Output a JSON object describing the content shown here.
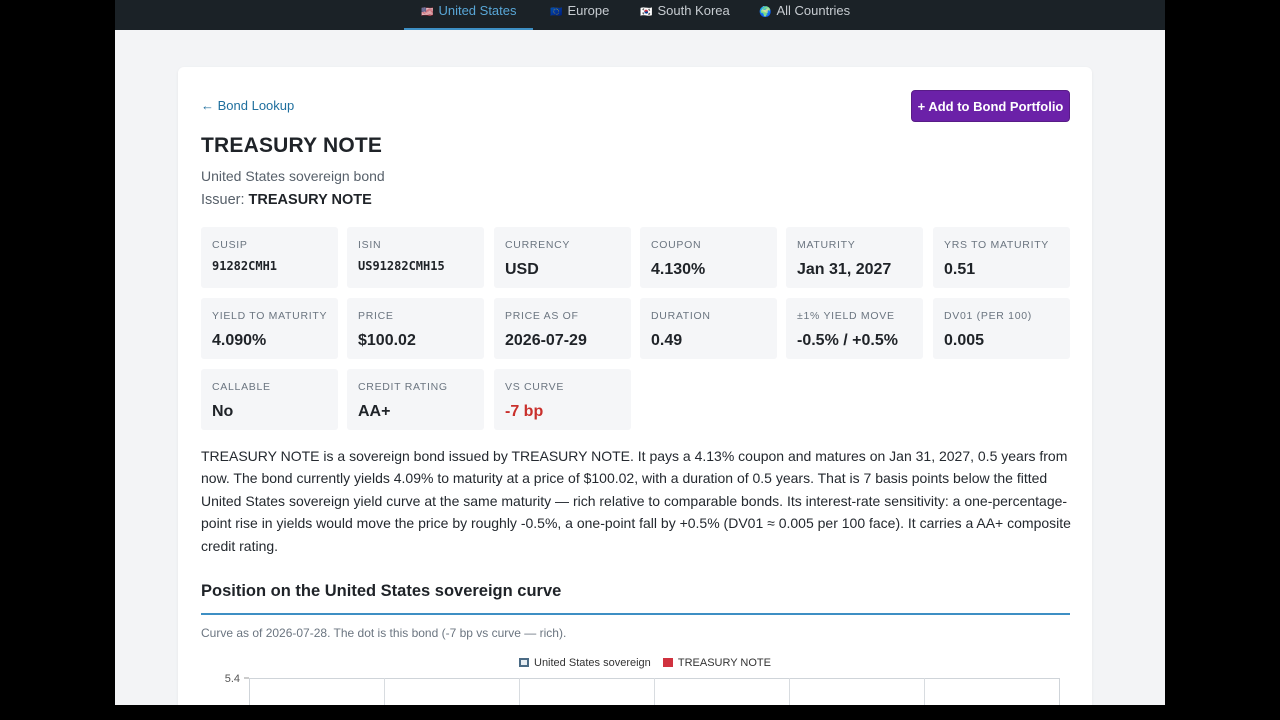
{
  "nav": {
    "tabs": [
      {
        "flag": "🇺🇸",
        "label": "United States",
        "active": true
      },
      {
        "flag": "🇪🇺",
        "label": "Europe",
        "active": false
      },
      {
        "flag": "🇰🇷",
        "label": "South Korea",
        "active": false
      },
      {
        "flag": "🌍",
        "label": "All Countries",
        "active": false
      }
    ]
  },
  "header": {
    "back_label": "← Bond Lookup",
    "add_button_label": "+ Add to Bond Portfolio"
  },
  "bond": {
    "title": "TREASURY NOTE",
    "subtitle": "United States sovereign bond",
    "issuer_label": "Issuer:",
    "issuer_name": "TREASURY NOTE"
  },
  "stats": [
    {
      "label": "CUSIP",
      "value": "91282CMH1"
    },
    {
      "label": "ISIN",
      "value": "US91282CMH15"
    },
    {
      "label": "CURRENCY",
      "value": "USD"
    },
    {
      "label": "COUPON",
      "value": "4.130%"
    },
    {
      "label": "MATURITY",
      "value": "Jan 31, 2027"
    },
    {
      "label": "YRS TO MATURITY",
      "value": "0.51"
    },
    {
      "label": "YIELD TO MATURITY",
      "value": "4.090%"
    },
    {
      "label": "PRICE",
      "value": "$100.02"
    },
    {
      "label": "PRICE AS OF",
      "value": "2026-07-29"
    },
    {
      "label": "DURATION",
      "value": "0.49"
    },
    {
      "label": "±1% YIELD MOVE",
      "value": "-0.5% / +0.5%"
    },
    {
      "label": "DV01 (PER 100)",
      "value": "0.005"
    },
    {
      "label": "CALLABLE",
      "value": "No"
    },
    {
      "label": "CREDIT RATING",
      "value": "AA+"
    },
    {
      "label": "VS CURVE",
      "value": "-7 bp"
    }
  ],
  "colors": {
    "accent": "#3d8fc4",
    "button_purple": "#6b21a8",
    "negative_red": "#c9302c",
    "bond_dot_red": "#d0323f"
  },
  "description": "TREASURY NOTE is a sovereign bond issued by TREASURY NOTE. It pays a 4.13% coupon and matures on Jan 31, 2027, 0.5 years from now. The bond currently yields 4.09% to maturity at a price of $100.02, with a duration of 0.5 years. That is 7 basis points below the fitted United States sovereign yield curve at the same maturity — rich relative to comparable bonds. Its interest-rate sensitivity: a one-percentage-point rise in yields would move the price by roughly -0.5%, a one-point fall by +0.5% (DV01 ≈ 0.005 per 100 face). It carries a AA+ composite credit rating.",
  "curve_section": {
    "title": "Position on the United States sovereign curve",
    "note": "Curve as of 2026-07-28. The dot is this bond (-7 bp vs curve — rich)."
  },
  "chart_data": {
    "type": "line",
    "series": [
      {
        "name": "United States sovereign"
      },
      {
        "name": "TREASURY NOTE"
      }
    ],
    "y_tick_labels": [
      "5.4"
    ]
  }
}
